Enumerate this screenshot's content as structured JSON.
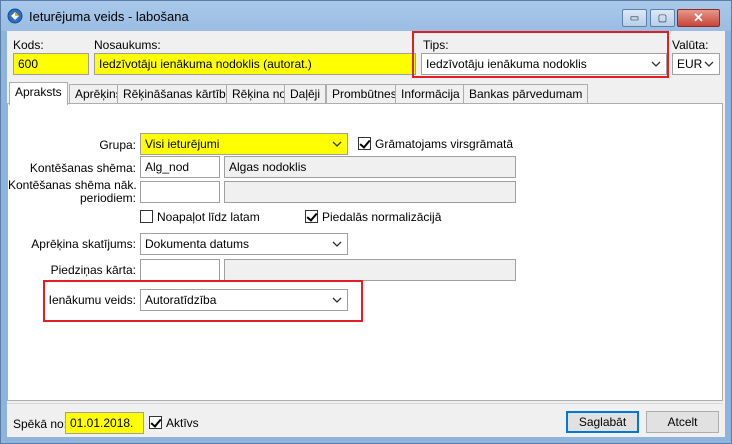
{
  "window": {
    "title": "Ieturējuma veids - labošana",
    "controls": {
      "minimize": "▭",
      "maximize": "▢",
      "close": "✕"
    }
  },
  "header": {
    "kods_label": "Kods:",
    "kods_value": "600",
    "nosaukums_label": "Nosaukums:",
    "nosaukums_value": "Iedzīvotāju ienākuma nodoklis (autorat.)",
    "tips_label": "Tips:",
    "tips_value": "Iedzīvotāju ienākuma nodoklis",
    "valuta_label": "Valūta:",
    "valuta_value": "EUR"
  },
  "tabs": [
    "Apraksts",
    "Aprēķins",
    "Rēķināšanas kārtība",
    "Rēķina no",
    "Daļēji",
    "Prombūtnes",
    "Informācija",
    "Bankas pārvedumam"
  ],
  "apraksts": {
    "grupa_label": "Grupa:",
    "grupa_value": "Visi ieturējumi",
    "gramatojams_label": "Grāmatojams virsgrāmatā",
    "gramatojams_checked": true,
    "kontesanas_label": "Kontēšanas shēma:",
    "kontesanas_code": "Alg_nod",
    "kontesanas_desc": "Algas nodoklis",
    "kontesanas_nak_label_1": "Kontēšanas shēma nāk.",
    "kontesanas_nak_label_2": "periodiem:",
    "kontesanas_nak_code": "",
    "kontesanas_nak_desc": "",
    "noapalot_label": "Noapaļot līdz latam",
    "noapalot_checked": false,
    "piedalas_label": "Piedalās normalizācijā",
    "piedalas_checked": true,
    "aprekina_label": "Aprēķina skatījums:",
    "aprekina_value": "Dokumenta datums",
    "piedzinas_label": "Piedziņas kārta:",
    "piedzinas_code": "",
    "piedzinas_desc": "",
    "ienakumu_label": "Ienākumu veids:",
    "ienakumu_value": "Autoratīdzība"
  },
  "footer": {
    "speka_label": "Spēkā no:",
    "speka_value": "01.01.2018.",
    "aktivs_label": "Aktīvs",
    "aktivs_checked": true,
    "save_label": "Saglabāt",
    "cancel_label": "Atcelt"
  },
  "colors": {
    "highlight_yellow": "#ffff00",
    "annotation_red": "#e01e24",
    "window_frame": "#9bbde3"
  }
}
